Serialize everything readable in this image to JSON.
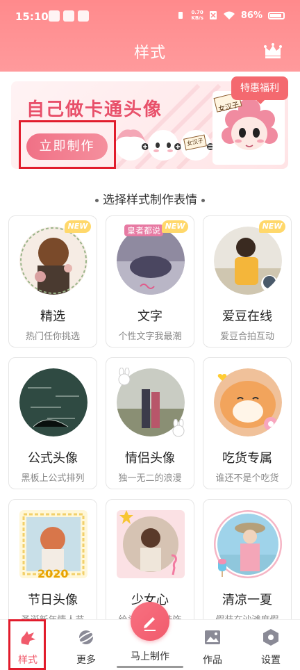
{
  "status": {
    "time": "15:10",
    "net_speed_value": "0.70",
    "net_speed_unit": "KB/s",
    "battery": "86%"
  },
  "header": {
    "title": "样式"
  },
  "banner": {
    "title": "自己做卡通头像",
    "button_label": "立即制作",
    "promo_label": "特惠福利",
    "sign_text": "女汉子"
  },
  "section": {
    "title": "选择样式制作表情"
  },
  "cards": [
    {
      "name": "精选",
      "desc": "热门任你挑选",
      "tag": "NEW"
    },
    {
      "name": "文字",
      "desc": "个性文字我最潮",
      "tag": "NEW",
      "overlay": "皇者都说"
    },
    {
      "name": "爱豆在线",
      "desc": "爱豆合拍互动",
      "tag": "NEW"
    },
    {
      "name": "公式头像",
      "desc": "黑板上公式排列"
    },
    {
      "name": "情侣头像",
      "desc": "独一无二的浪漫"
    },
    {
      "name": "吃货专属",
      "desc": "谁还不是个吃货"
    },
    {
      "name": "节日头像",
      "desc": "圣诞新年情人节",
      "overlay": "2020"
    },
    {
      "name": "少女心",
      "desc": "给头像加上挂饰"
    },
    {
      "name": "清凉一夏",
      "desc": "假装在沙滩度假"
    }
  ],
  "nav": {
    "items": [
      {
        "label": "样式"
      },
      {
        "label": "更多"
      },
      {
        "label": "马上制作"
      },
      {
        "label": "作品"
      },
      {
        "label": "设置"
      }
    ]
  },
  "colors": {
    "accent": "#f05a6b",
    "header": "#ff8a8c",
    "highlight": "#e11c2c"
  }
}
